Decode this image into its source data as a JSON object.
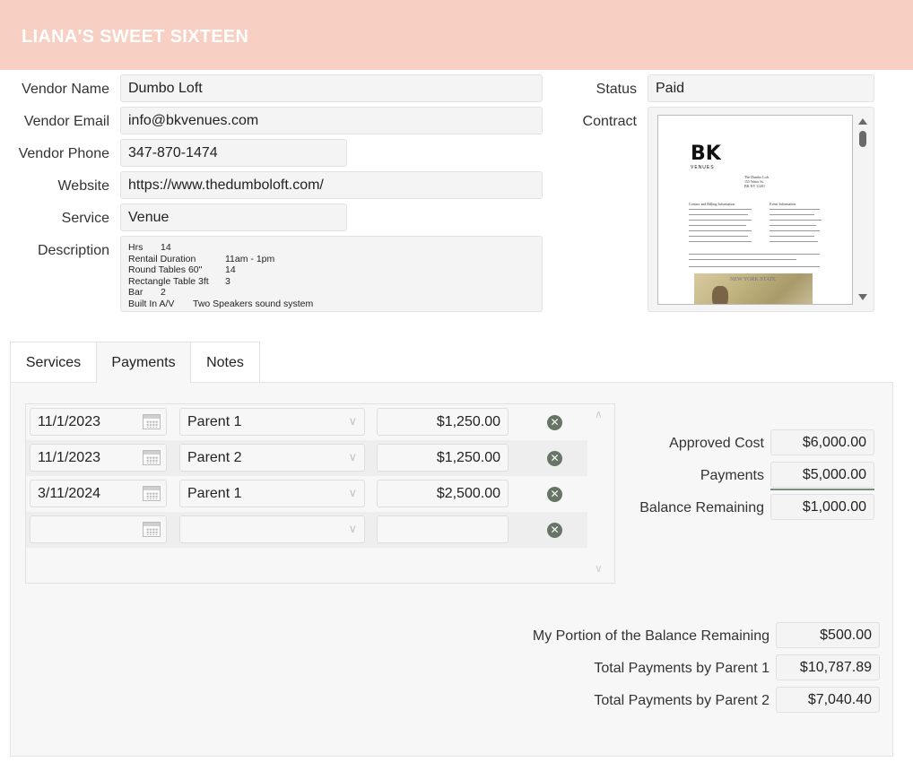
{
  "header": {
    "title": "LIANA'S SWEET SIXTEEN"
  },
  "vendor": {
    "name_label": "Vendor Name",
    "name": "Dumbo Loft",
    "email_label": "Vendor Email",
    "email": "info@bkvenues.com",
    "phone_label": "Vendor Phone",
    "phone": "347-870-1474",
    "website_label": "Website",
    "website": "https://www.thedumboloft.com/",
    "service_label": "Service",
    "service": "Venue",
    "description_label": "Description",
    "description_lines": [
      {
        "k": "Hrs",
        "v": "14"
      },
      {
        "k": "Rentail Duration",
        "v": "11am - 1pm"
      },
      {
        "k": "Round Tables 60\"",
        "v": "14"
      },
      {
        "k": "Rectangle Table 3ft",
        "v": "3"
      },
      {
        "k": "Bar",
        "v": "2"
      },
      {
        "k": "Built In A/V",
        "v": "Two Speakers sound system"
      }
    ],
    "status_label": "Status",
    "status": "Paid",
    "contract_label": "Contract",
    "contract_doc": {
      "logo": "BK",
      "logo_sub": "VENUES",
      "addr1": "The Dumbo Loft",
      "addr2": "155 Water St.",
      "addr3": "BK NY 11201",
      "contact_heading": "Contact and Billing Information",
      "event_heading": "Event Information",
      "stamp": "NEW YORK STATE"
    }
  },
  "tabs": [
    {
      "label": "Services"
    },
    {
      "label": "Payments"
    },
    {
      "label": "Notes"
    }
  ],
  "payments": [
    {
      "date": "11/1/2023",
      "payer": "Parent 1",
      "amount": "$1,250.00"
    },
    {
      "date": "11/1/2023",
      "payer": "Parent 2",
      "amount": "$1,250.00"
    },
    {
      "date": "3/11/2024",
      "payer": "Parent 1",
      "amount": "$2,500.00"
    },
    {
      "date": "",
      "payer": "",
      "amount": ""
    }
  ],
  "summary": {
    "approved_cost_label": "Approved Cost",
    "approved_cost": "$6,000.00",
    "payments_label": "Payments",
    "payments": "$5,000.00",
    "balance_label": "Balance Remaining",
    "balance": "$1,000.00"
  },
  "totals": {
    "my_portion_label": "My Portion of the Balance Remaining",
    "my_portion": "$500.00",
    "parent1_label": "Total Payments by Parent 1",
    "parent1": "$10,787.89",
    "parent2_label": "Total Payments by Parent 2",
    "parent2": "$7,040.40"
  },
  "colors": {
    "header": "#f7cfc3",
    "delete_icon": "#667566"
  }
}
